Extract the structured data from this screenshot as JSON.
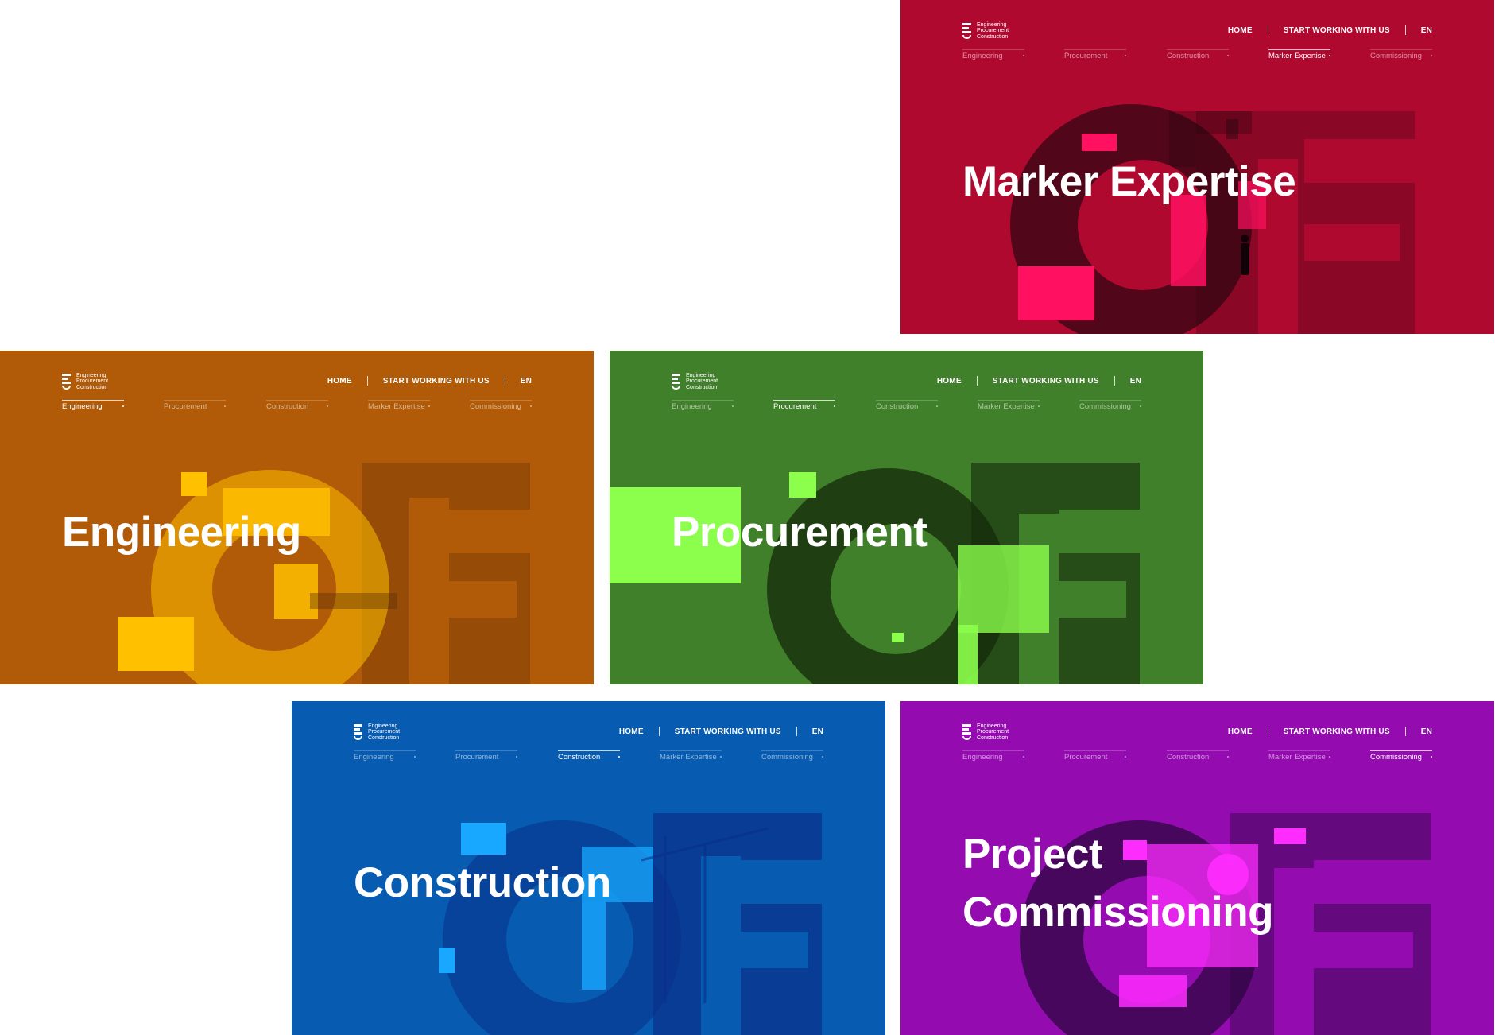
{
  "brand": {
    "logo_lines": [
      "Engineering",
      "Procurement",
      "Construction"
    ]
  },
  "nav": {
    "home": "HOME",
    "start": "START WORKING WITH US",
    "lang": "EN"
  },
  "subnav": [
    "Engineering",
    "Procurement",
    "Construction",
    "Marker Expertise",
    "Commissioning"
  ],
  "panels": {
    "marker": {
      "title": "Marker Expertise",
      "active_index": 3,
      "colors": {
        "bg": "#b00930",
        "accent": "#ff1060",
        "dark": "#2a0510"
      }
    },
    "engineering": {
      "title": "Engineering",
      "active_index": 0,
      "colors": {
        "bg": "#b15a07",
        "accent": "#ffc000",
        "dark": "#5a3008"
      }
    },
    "procurement": {
      "title": "Procurement",
      "active_index": 1,
      "colors": {
        "bg": "#41802a",
        "accent": "#8cff4c",
        "dark": "#142a0c"
      }
    },
    "construction": {
      "title": "Construction",
      "active_index": 2,
      "colors": {
        "bg": "#075bb0",
        "accent": "#18a8ff",
        "dark": "#0a2f8a"
      }
    },
    "commissioning": {
      "title_line1": "Project",
      "title_line2": "Commissioning",
      "active_index": 4,
      "colors": {
        "bg": "#940cb0",
        "accent": "#ff2cff",
        "dark": "#2c0642"
      }
    }
  }
}
